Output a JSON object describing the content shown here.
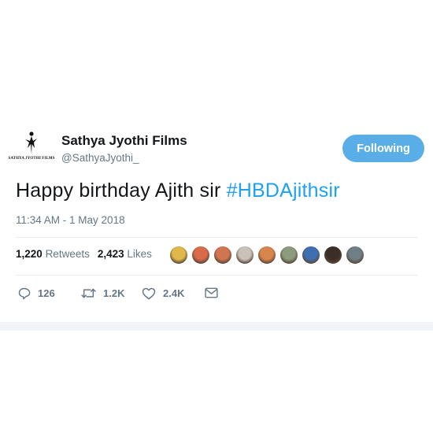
{
  "tweet": {
    "author": {
      "avatar_caption": "SATHYA JYOTHI FILMS",
      "name": "Sathya Jyothi Films",
      "handle": "@SathyaJyothi_"
    },
    "follow_button_label": "Following",
    "text": "Happy birthday Ajith sir ",
    "hashtag": "#HBDAjithsir",
    "timestamp": "11:34 AM - 1 May 2018",
    "stats": {
      "retweets_count": "1,220",
      "retweets_label": "Retweets",
      "likes_count": "2,423",
      "likes_label": "Likes"
    },
    "liked_by_avatars": [
      "#e0b84a",
      "#d86b4a",
      "#d07550",
      "#c9c2bb",
      "#d8864e",
      "#8c9a7e",
      "#3f6fb0",
      "#3a2e26",
      "#6e7f86"
    ],
    "actions": {
      "replies": "126",
      "retweets": "1.2K",
      "likes": "2.4K"
    }
  },
  "colors": {
    "accent": "#1da1f2",
    "follow_button": "#5aaee8",
    "secondary_text": "#657786"
  }
}
